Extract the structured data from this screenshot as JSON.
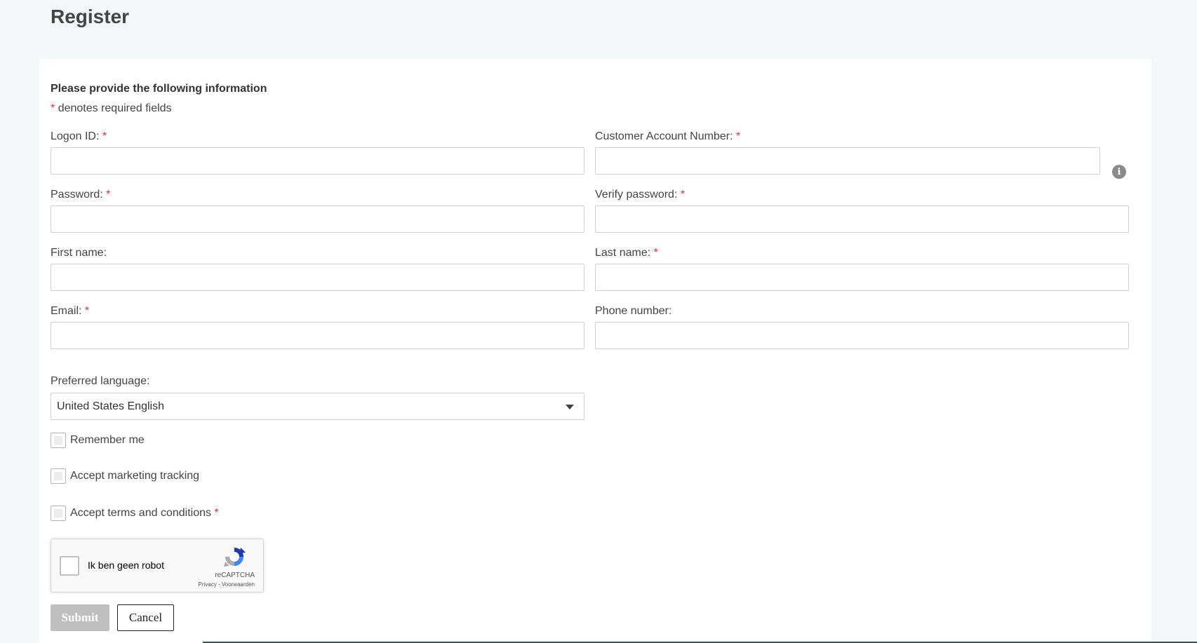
{
  "page": {
    "title": "Register"
  },
  "form": {
    "intro_heading": "Please provide the following information",
    "required_star": "*",
    "required_note": "denotes required fields",
    "fields": {
      "logon_id": {
        "label": "Logon ID:",
        "value": ""
      },
      "customer_account_number": {
        "label": "Customer Account Number:",
        "value": ""
      },
      "password": {
        "label": "Password:",
        "value": ""
      },
      "verify_password": {
        "label": "Verify password:",
        "value": ""
      },
      "first_name": {
        "label": "First name:",
        "value": ""
      },
      "last_name": {
        "label": "Last name:",
        "value": ""
      },
      "email": {
        "label": "Email:",
        "value": ""
      },
      "phone_number": {
        "label": "Phone number:",
        "value": ""
      }
    },
    "info_icon_glyph": "i",
    "preferred_language": {
      "label": "Preferred language:",
      "selected": "United States English"
    },
    "checkboxes": {
      "remember_me": {
        "label": "Remember me",
        "checked": false
      },
      "marketing_tracking": {
        "label": "Accept marketing tracking",
        "checked": false
      },
      "terms": {
        "label": "Accept terms and conditions",
        "checked": false
      }
    },
    "recaptcha": {
      "label": "Ik ben geen robot",
      "brand": "reCAPTCHA",
      "links": "Privacy - Voorwaarden"
    },
    "buttons": {
      "submit": "Submit",
      "cancel": "Cancel"
    }
  },
  "colors": {
    "background": "#f4f7f8",
    "required_star": "#d9303d",
    "submit_disabled": "#bfbfbf"
  },
  "icons": [
    "info-icon",
    "chevron-down-icon",
    "recaptcha-logo-icon"
  ]
}
